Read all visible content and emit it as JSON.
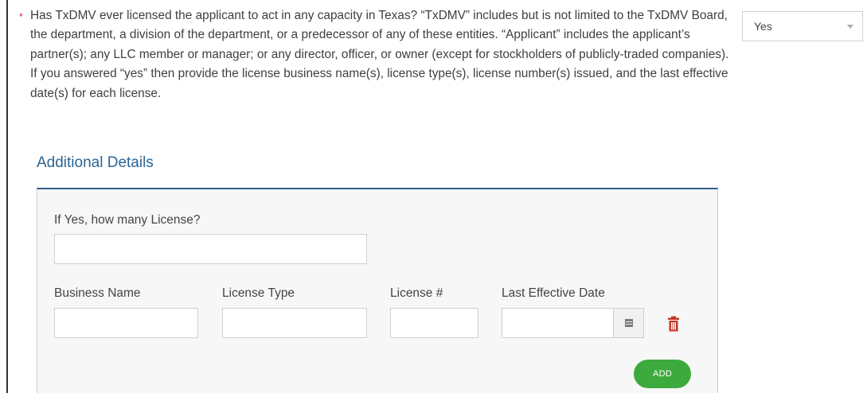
{
  "question": {
    "required_marker": "*",
    "text": "Has TxDMV ever licensed the applicant to act in any capacity in Texas? “TxDMV” includes but is not limited to the TxDMV Board, the department, a division of the department, or a predecessor of any of these entities. “Applicant” includes the applicant’s partner(s); any LLC member or manager; or any director, officer, or owner (except for stockholders of publicly-traded companies). If you answered “yes” then provide the license business name(s), license type(s), license number(s) issued, and the last effective date(s) for each license.",
    "answer": {
      "selected": "Yes",
      "icon": "chevron-down-icon"
    }
  },
  "additional_details": {
    "title": "Additional Details",
    "how_many": {
      "label": "If Yes, how many License?",
      "value": ""
    },
    "columns": {
      "business_name": "Business Name",
      "license_type": "License Type",
      "license_number": "License #",
      "last_effective_date": "Last Effective Date"
    },
    "row": {
      "business_name": "",
      "license_type": "",
      "license_number": "",
      "last_effective_date": "",
      "calendar_icon": "calendar-icon",
      "delete_icon": "trash-icon"
    },
    "add_button": "ADD"
  },
  "colors": {
    "link_blue": "#2a6496",
    "panel_border": "#2f5f8a",
    "required_red": "#cc2222",
    "delete_red": "#c0392b",
    "add_green": "#3daa3d"
  }
}
